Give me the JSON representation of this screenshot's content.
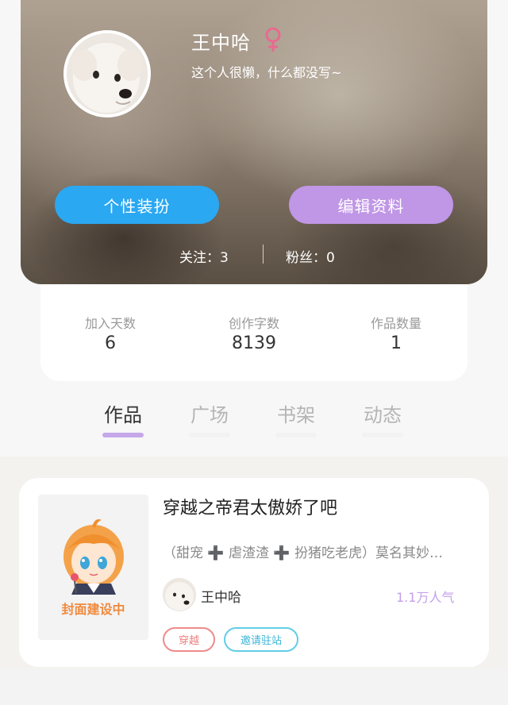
{
  "profile": {
    "name": "王中哈",
    "bio": "这个人很懒，什么都没写~",
    "gender_icon": "female-icon",
    "customize_label": "个性装扮",
    "edit_label": "编辑资料",
    "following_text": "关注：3",
    "followers_text": "粉丝：0"
  },
  "stats": [
    {
      "label": "加入天数",
      "value": "6"
    },
    {
      "label": "创作字数",
      "value": "8139"
    },
    {
      "label": "作品数量",
      "value": "1"
    }
  ],
  "tabs": [
    {
      "label": "作品",
      "active": true
    },
    {
      "label": "广场",
      "active": false
    },
    {
      "label": "书架",
      "active": false
    },
    {
      "label": "动态",
      "active": false
    }
  ],
  "work": {
    "cover_text": "封面建设中",
    "title": "穿越之帝君太傲娇了吧",
    "description": "（甜宠 ➕ 虐渣渣 ➕ 扮猪吃老虎）莫名其妙…",
    "author": "王中哈",
    "popularity": "1.1万人气",
    "tags": [
      "穿越",
      "邀请驻站"
    ]
  },
  "colors": {
    "accent_blue": "#2aa8f2",
    "accent_purple": "#c096e6",
    "tab_active_underline": "#c5a7ea",
    "popularity": "#c3a0ea",
    "gender": "#e86a8f"
  }
}
